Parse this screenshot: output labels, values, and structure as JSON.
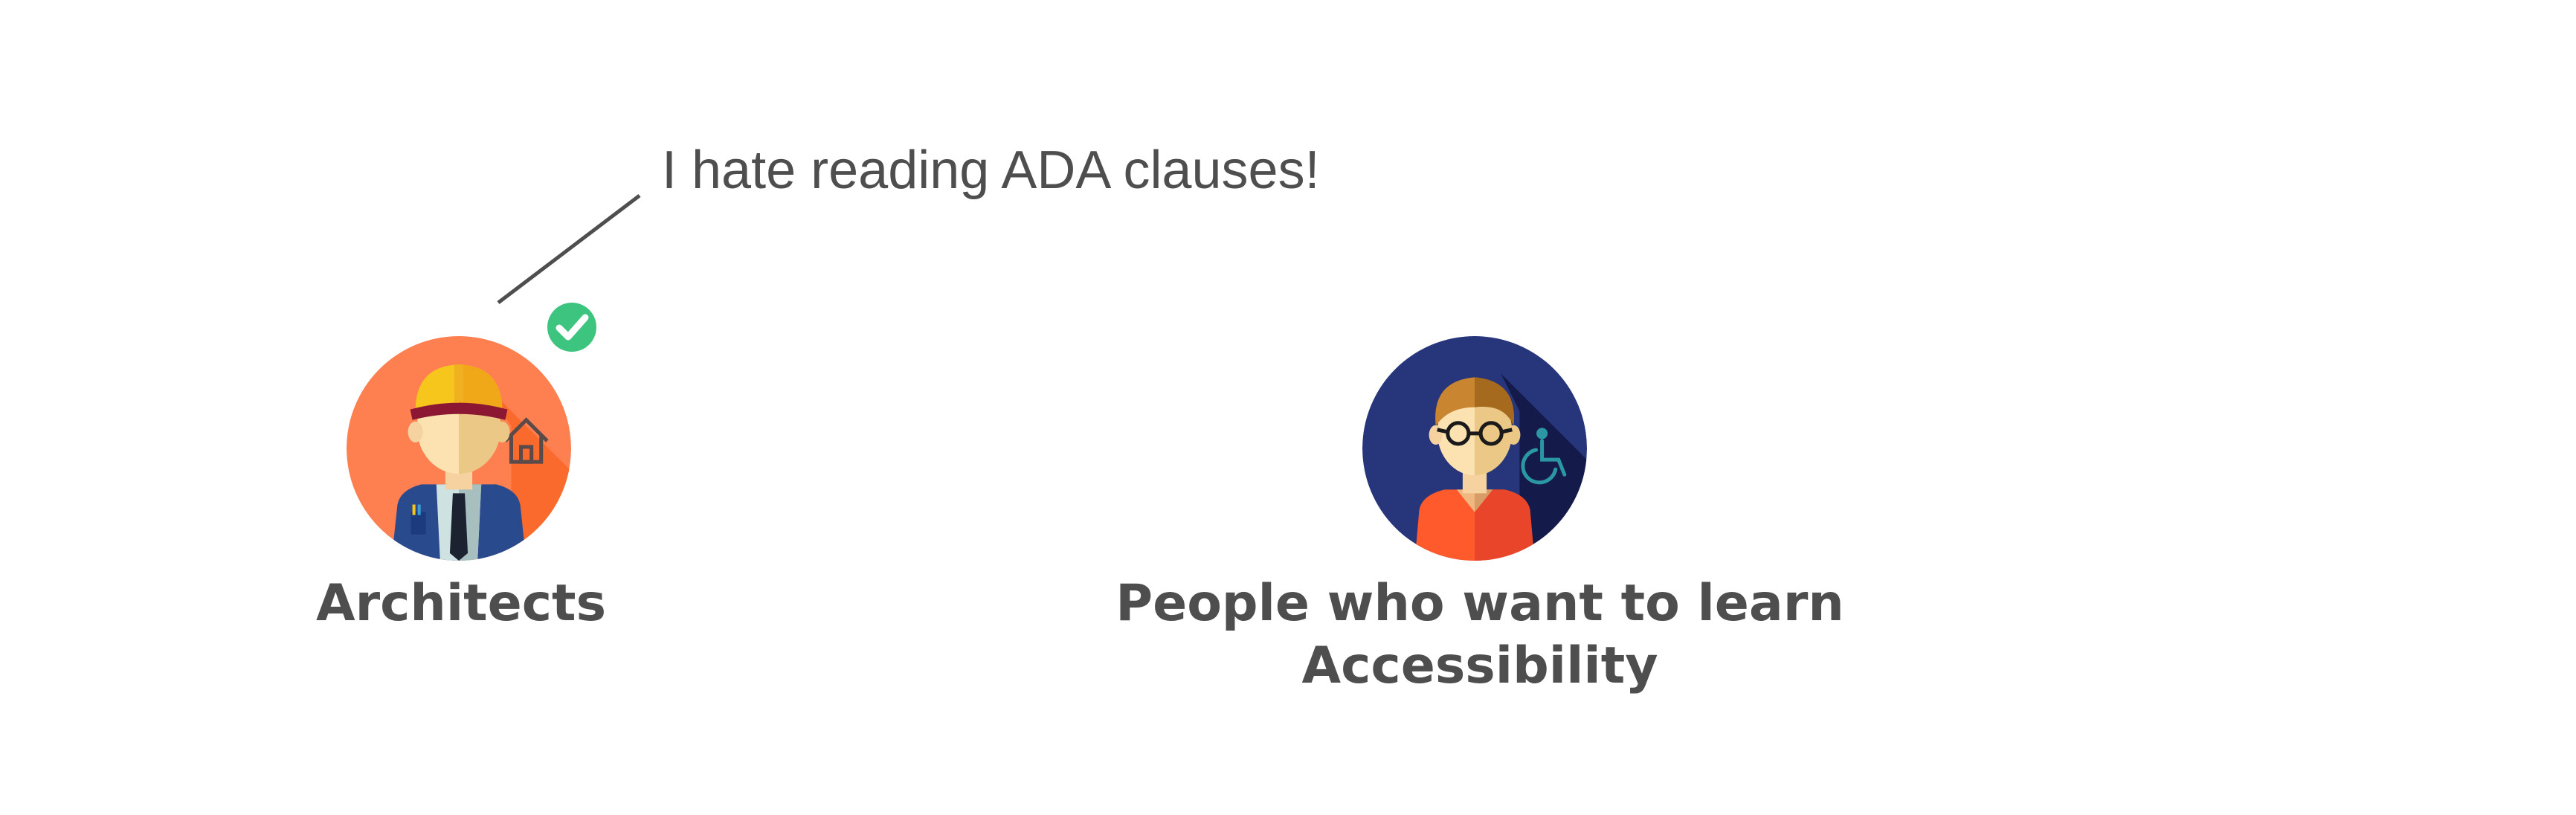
{
  "speech_bubble": {
    "text": "I hate reading ADA clauses!"
  },
  "personas": [
    {
      "label": "Architects",
      "avatar": "architect-avatar",
      "badge": "check-icon"
    },
    {
      "label_lines": [
        "People who want to learn",
        "Accessibility"
      ],
      "avatar": "accessibility-learner-avatar"
    }
  ],
  "colors": {
    "text": "#4e4e4e",
    "architect_bg": "#fe7f50",
    "learner_bg": "#27367a",
    "check_badge": "#3dc47e"
  }
}
